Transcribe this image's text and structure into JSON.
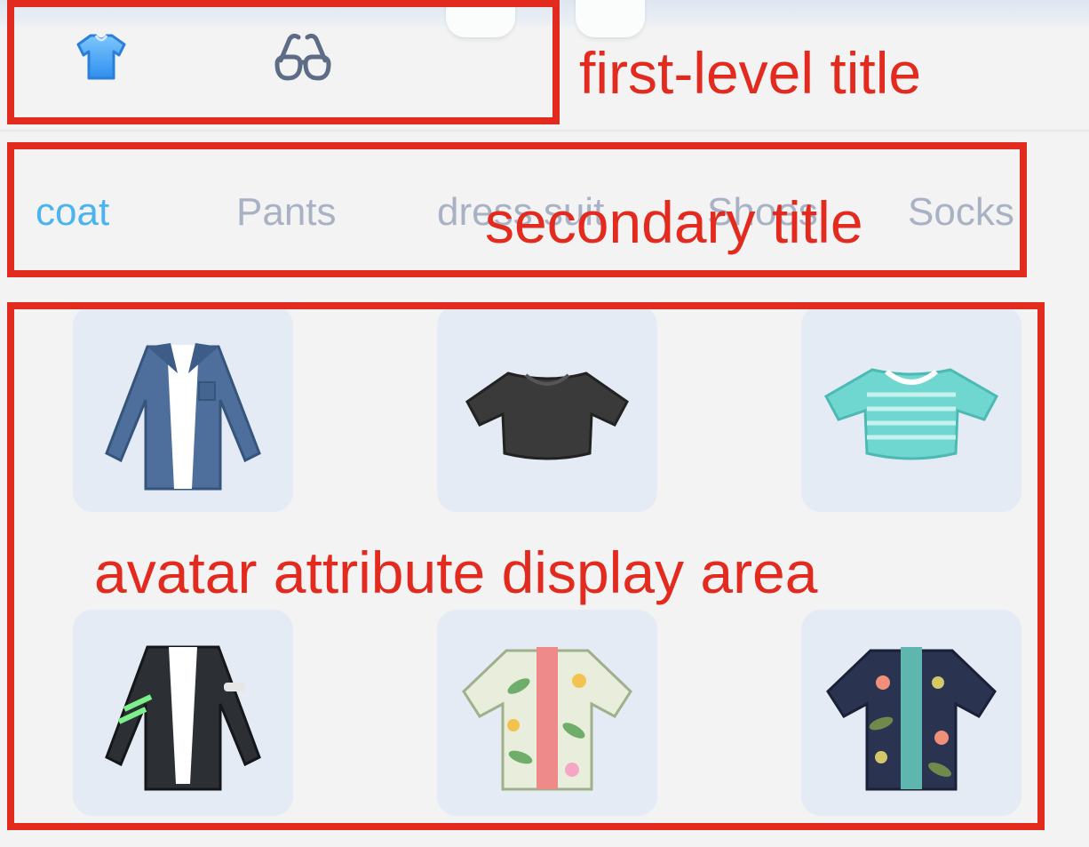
{
  "categories": [
    {
      "name": "shirt-icon",
      "color": "#4aa8f0",
      "active": true
    },
    {
      "name": "glasses-icon",
      "color": "#5d6c86",
      "active": false
    }
  ],
  "subcategories": [
    {
      "label": "coat",
      "active": true
    },
    {
      "label": "Pants",
      "active": false
    },
    {
      "label": "dress suit",
      "active": false
    },
    {
      "label": "Shoes",
      "active": false
    },
    {
      "label": "Socks",
      "active": false
    }
  ],
  "items": [
    {
      "name": "denim-jacket"
    },
    {
      "name": "black-crop-tee"
    },
    {
      "name": "teal-striped-crop-tee"
    },
    {
      "name": "black-varsity-jacket"
    },
    {
      "name": "floral-hawaiian-shirt-light"
    },
    {
      "name": "floral-hawaiian-shirt-dark"
    }
  ],
  "annotations": {
    "first_level": "first-level title",
    "secondary": "secondary title",
    "attribute_area": "avatar attribute display area"
  },
  "colors": {
    "annotation": "#e32a1f",
    "accent": "#4bb3ee",
    "tab_inactive": "#a9b2c4",
    "tile_bg": "#e4ebf5"
  }
}
